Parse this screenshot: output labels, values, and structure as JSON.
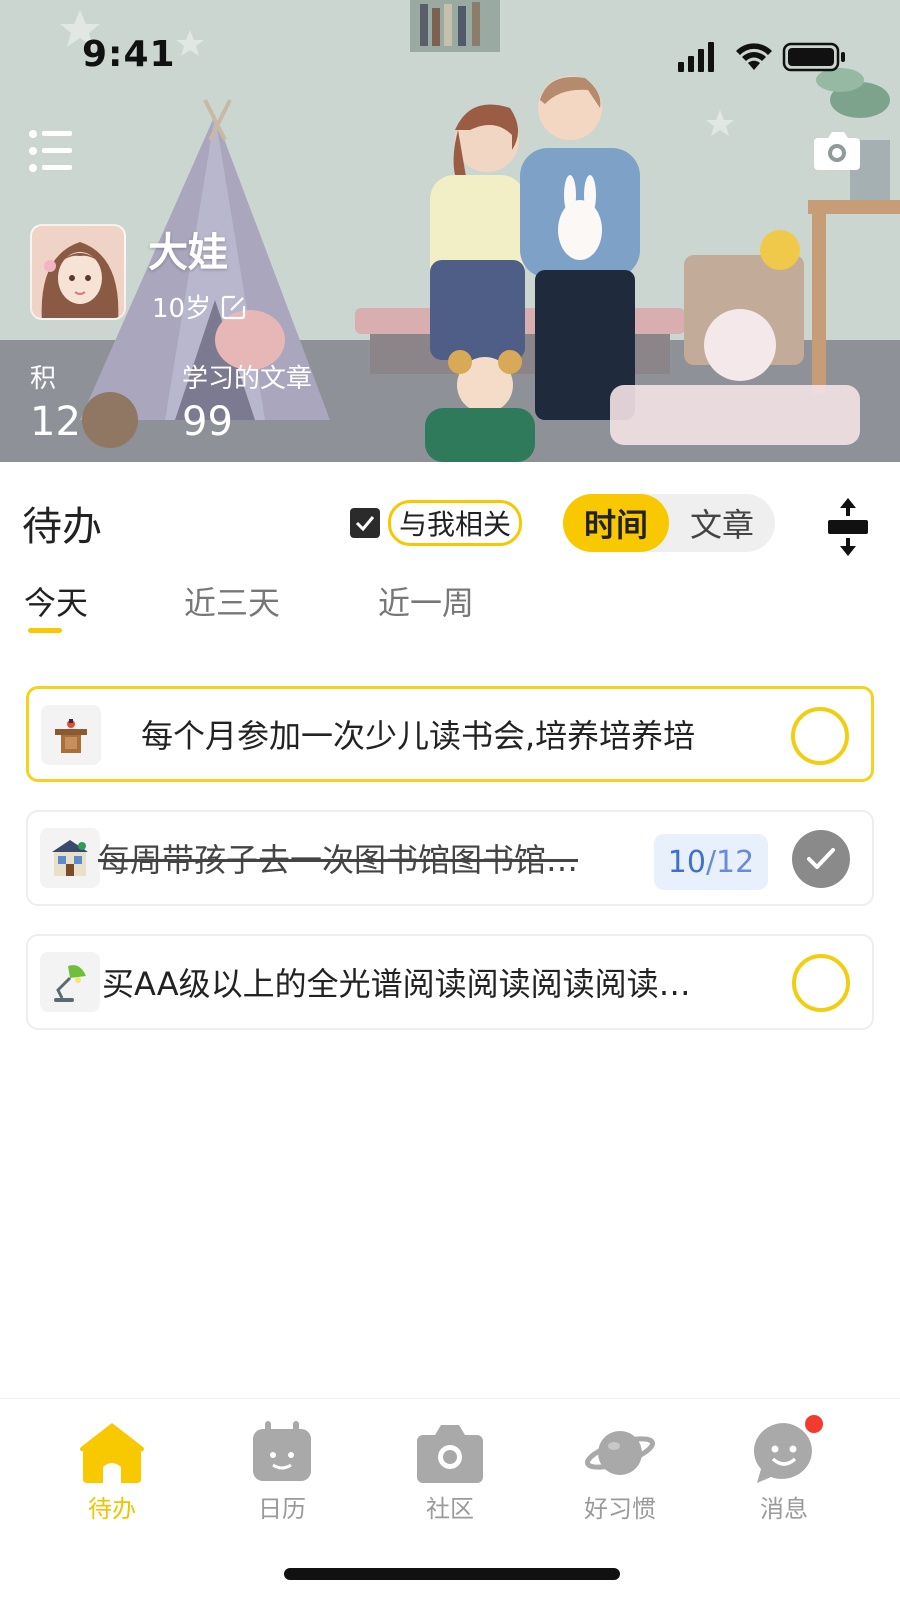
{
  "status_bar": {
    "time": "9:41"
  },
  "profile": {
    "name": "大娃",
    "age": "10岁",
    "stats": [
      {
        "label": "积",
        "value": "12"
      },
      {
        "label": "学习的文章",
        "value": "99"
      }
    ]
  },
  "todo": {
    "title": "待办",
    "related_label": "与我相关",
    "related_checked": true,
    "sort_options": [
      "时间",
      "文章"
    ],
    "sort_active": "时间"
  },
  "tabs": [
    "今天",
    "近三天",
    "近一周"
  ],
  "tasks": [
    {
      "icon": "podium-icon",
      "text": "每个月参加一次少儿读书会,培养培养培",
      "done": false,
      "highlighted": true
    },
    {
      "icon": "library-icon",
      "text": "每周带孩子去一次图书馆图书馆…",
      "done": true,
      "progress_current": "10",
      "progress_sep": "/",
      "progress_total": "12"
    },
    {
      "icon": "desk-lamp-icon",
      "text": "买AA级以上的全光谱阅读阅读阅读阅读…",
      "done": false
    }
  ],
  "bottom_nav": [
    {
      "label": "待办",
      "icon": "home-icon",
      "active": true
    },
    {
      "label": "日历",
      "icon": "calendar-icon"
    },
    {
      "label": "社区",
      "icon": "camera-icon"
    },
    {
      "label": "好习惯",
      "icon": "planet-icon"
    },
    {
      "label": "消息",
      "icon": "chat-icon",
      "badge": true
    }
  ],
  "colors": {
    "accent": "#f8c800",
    "progress": "#3f6fd1",
    "badge": "#f23a2f"
  }
}
